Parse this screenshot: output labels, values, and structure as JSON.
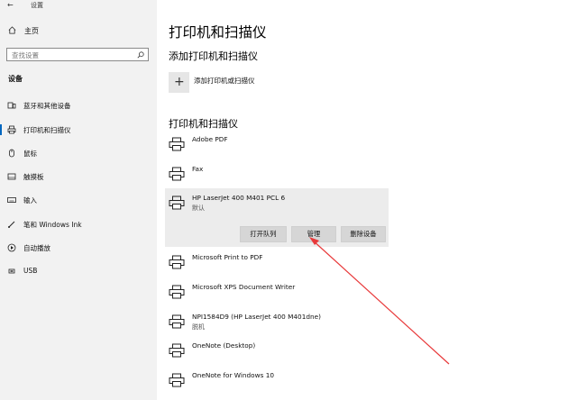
{
  "window": {
    "title": "设置"
  },
  "sidebar": {
    "home_label": "主页",
    "search_placeholder": "查找设置",
    "section_title": "设备",
    "items": [
      {
        "label": "蓝牙和其他设备",
        "icon": "bluetooth-icon"
      },
      {
        "label": "打印机和扫描仪",
        "icon": "printer-icon",
        "active": true
      },
      {
        "label": "鼠标",
        "icon": "mouse-icon"
      },
      {
        "label": "触摸板",
        "icon": "touchpad-icon"
      },
      {
        "label": "输入",
        "icon": "keyboard-icon"
      },
      {
        "label": "笔和 Windows Ink",
        "icon": "pen-icon"
      },
      {
        "label": "自动播放",
        "icon": "autoplay-icon"
      },
      {
        "label": "USB",
        "icon": "usb-icon"
      }
    ]
  },
  "main": {
    "title": "打印机和扫描仪",
    "add_section_title": "添加打印机和扫描仪",
    "add_button_label": "添加打印机或扫描仪",
    "list_title": "打印机和扫描仪",
    "devices": [
      {
        "name": "Adobe PDF",
        "status": ""
      },
      {
        "name": "Fax",
        "status": ""
      },
      {
        "name": "HP LaserJet 400 M401 PCL 6",
        "status": "默认",
        "selected": true
      },
      {
        "name": "Microsoft Print to PDF",
        "status": ""
      },
      {
        "name": "Microsoft XPS Document Writer",
        "status": ""
      },
      {
        "name": "NPI1584D9 (HP LaserJet 400 M401dne)",
        "status": "脱机"
      },
      {
        "name": "OneNote (Desktop)",
        "status": ""
      },
      {
        "name": "OneNote for Windows 10",
        "status": ""
      }
    ],
    "selected_actions": {
      "open_queue": "打开队列",
      "manage": "管理",
      "remove": "删除设备"
    }
  },
  "colors": {
    "accent": "#0067c0",
    "annotation_arrow": "#e8393a"
  }
}
